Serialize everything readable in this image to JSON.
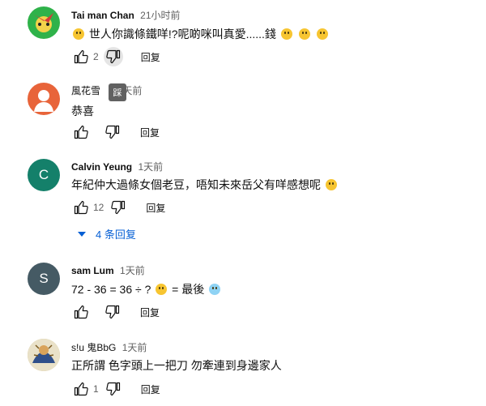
{
  "comments": [
    {
      "author": "Tai man Chan",
      "time": "21小时前",
      "text_parts": [
        "世人你識條鐵咩!?呢啲咪叫真愛......錢"
      ],
      "likes": "2",
      "reply": "回复",
      "avatar_colors": [
        "#2fb24a",
        "#d63a3a"
      ]
    },
    {
      "author": "風花雪",
      "time": "天前",
      "text_parts": [
        "恭喜"
      ],
      "likes": "",
      "reply": "回复",
      "avatar_color": "#e8643a"
    },
    {
      "author": "Calvin Yeung",
      "time": "1天前",
      "text_parts": [
        "年紀仲大過條女個老豆，唔知未來岳父有咩感想呢"
      ],
      "likes": "12",
      "reply": "回复",
      "avatar_letter": "C",
      "avatar_color": "#14806a"
    },
    {
      "author": "sam Lum",
      "time": "1天前",
      "text_parts": [
        "72 - 36 = 36",
        "÷ ?",
        "= 最後"
      ],
      "likes": "",
      "reply": "回复",
      "avatar_letter": "S",
      "avatar_color": "#455a64"
    },
    {
      "author": "s!u 鬼BbG",
      "time": "1天前",
      "text_parts": [
        "正所謂  色字頭上一把刀  勿牽連到身邊家人"
      ],
      "likes": "1",
      "reply": "回复",
      "avatar_color": "#c9b26a"
    }
  ],
  "replies_toggle": {
    "label": "4 条回复"
  },
  "tooltip": {
    "label": "踩"
  }
}
